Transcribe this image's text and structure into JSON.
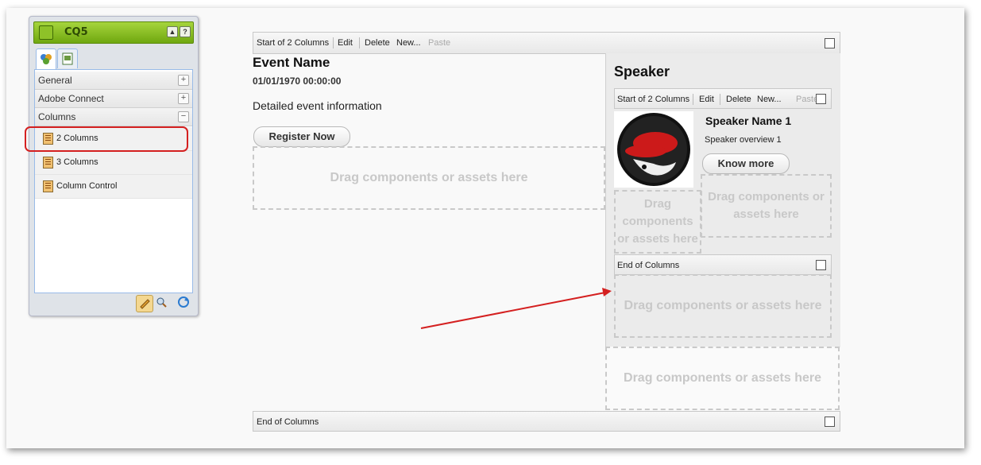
{
  "sidekick": {
    "title": "CQ5",
    "groups": [
      {
        "label": "General",
        "toggle": "+"
      },
      {
        "label": "Adobe Connect",
        "toggle": "+"
      },
      {
        "label": "Columns",
        "toggle": "−"
      }
    ],
    "components": [
      "2 Columns",
      "3 Columns",
      "Column Control"
    ],
    "header_buttons": [
      "▲",
      "?"
    ]
  },
  "page": {
    "outer_bar": {
      "start": "Start of 2 Columns",
      "edit": "Edit",
      "delete": "Delete",
      "new": "New...",
      "paste": "Paste"
    },
    "event_title": "Event Name",
    "event_date": "01/01/1970 00:00:00",
    "event_info": "Detailed event information",
    "register_label": "Register Now",
    "drag_text": "Drag components or assets here",
    "speaker_heading": "Speaker",
    "inner_bar": {
      "start": "Start of 2 Columns",
      "edit": "Edit",
      "delete": "Delete",
      "new": "New...",
      "paste": "Paste"
    },
    "speaker_name": "Speaker Name 1",
    "speaker_overview": "Speaker overview 1",
    "know_more_label": "Know more",
    "inner_end": "End of Columns",
    "outer_end": "End of Columns"
  },
  "colors": {
    "accent_green": "#8ec228",
    "annotation_red": "#d42020"
  }
}
